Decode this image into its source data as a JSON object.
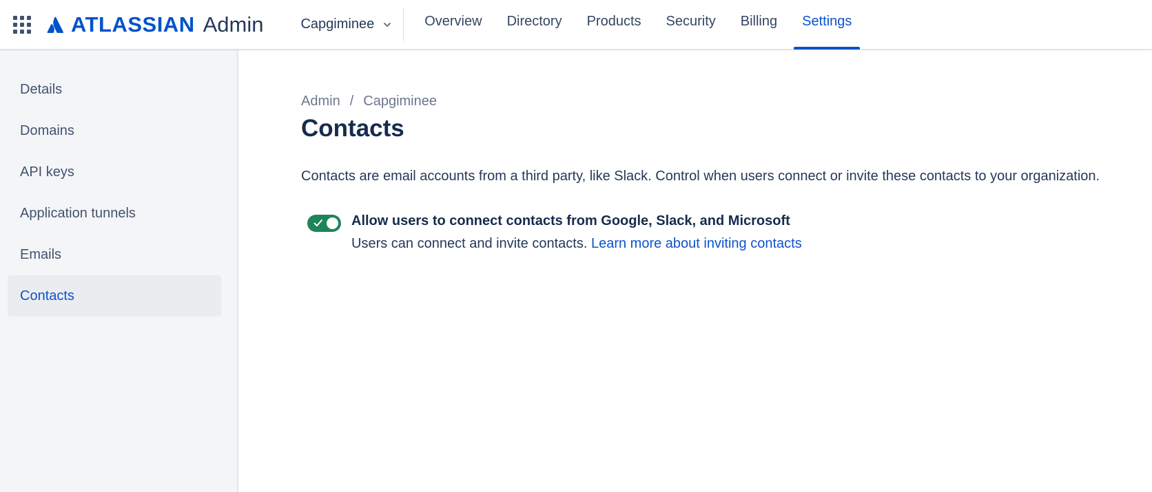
{
  "header": {
    "logo_word": "ATLASSIAN",
    "logo_product": "Admin",
    "org_name": "Capgiminee",
    "nav": [
      {
        "label": "Overview"
      },
      {
        "label": "Directory"
      },
      {
        "label": "Products"
      },
      {
        "label": "Security"
      },
      {
        "label": "Billing"
      },
      {
        "label": "Settings",
        "active": true
      }
    ]
  },
  "sidebar": {
    "items": [
      {
        "label": "Details"
      },
      {
        "label": "Domains"
      },
      {
        "label": "API keys"
      },
      {
        "label": "Application tunnels"
      },
      {
        "label": "Emails"
      },
      {
        "label": "Contacts",
        "active": true
      }
    ]
  },
  "main": {
    "breadcrumb": [
      "Admin",
      "/",
      "Capgiminee"
    ],
    "title": "Contacts",
    "description": "Contacts are email accounts from a third party, like Slack. Control when users connect or invite these contacts to your organization.",
    "setting": {
      "enabled": true,
      "title": "Allow users to connect contacts from Google, Slack, and Microsoft",
      "subtitle": "Users can connect and invite contacts.",
      "link": "Learn more about inviting contacts"
    }
  },
  "colors": {
    "brand": "#0052cc",
    "active": "#0c52cc",
    "toggle_on": "#1f845a",
    "sidebar_bg": "#f4f5f7"
  },
  "icons": [
    "app-switcher-icon",
    "atlassian-logo-icon",
    "chevron-down-icon",
    "check-icon"
  ]
}
